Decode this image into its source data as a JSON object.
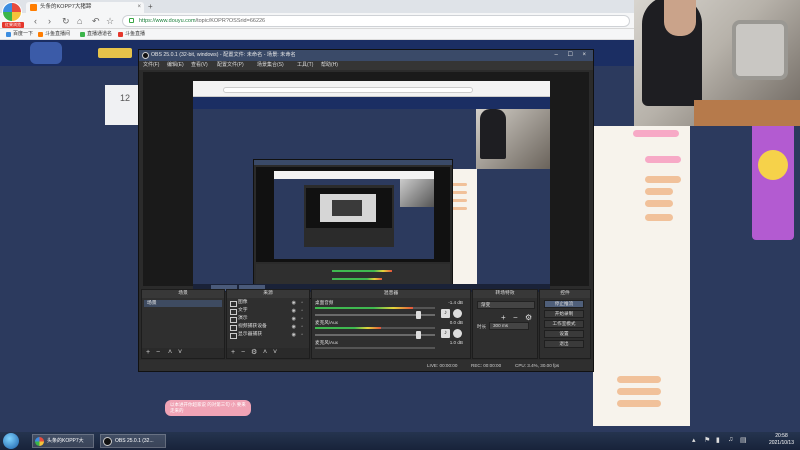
{
  "browser": {
    "logo_text": "红果浏览",
    "tab_title": "头条的KOPP7大猪蹄",
    "url_main": "https://www.douyu.com",
    "url_rest": "/topic/KOPR?OSSrid=66226",
    "bookmarks": [
      "百度一下",
      "斗鱼直播间",
      "直播通道名",
      "斗鱼直播"
    ]
  },
  "site": {
    "card_number": "12",
    "bottom_pill": "以本进开你超家说  的对第三句 小 要来 走来的"
  },
  "obs": {
    "title": "OBS 25.0.1 (32-bit, windows) - 配置文件: 未命名 - 场景: 未命名",
    "menu": [
      "文件(F)",
      "编辑(E)",
      "查看(V)",
      "配置文件(P)",
      "场景集合(S)",
      "工具(T)",
      "帮助(H)"
    ],
    "docks": {
      "scenes": "场景",
      "sources": "来源",
      "mixer": "混音器",
      "transitions": "转场特效",
      "controls": "控件"
    },
    "scenes": [
      "场景"
    ],
    "sources": [
      "图像",
      "文字",
      "演示",
      "视频捕获设备",
      "显示器捕获"
    ],
    "mixer": [
      {
        "name": "桌面音频",
        "db": "-1.4 dB",
        "level": 0.82,
        "volume": 0.86
      },
      {
        "name": "麦克风/Aux",
        "db": "0.0 dB",
        "level": 0.55,
        "volume": 0.86
      },
      {
        "name": "麦克风/Aux",
        "db": "1.0 dB",
        "level": 0.0,
        "volume": 0.5
      }
    ],
    "transition": {
      "selected": "渐变",
      "duration_label": "时长",
      "duration": "300 ms"
    },
    "controls": [
      "停止推流",
      "开始录制",
      "工作室模式",
      "设置",
      "退出"
    ],
    "status": {
      "live": "LIVE: 00:00:00",
      "rec": "REC: 00:00:00",
      "cpu": "CPU: 3.4%, 30.00 fps"
    }
  },
  "taskbar": {
    "items": [
      "头条的KOPP7大",
      "OBS 25.0.1 (32..."
    ],
    "time": "20:58",
    "date": "2021/10/13"
  }
}
